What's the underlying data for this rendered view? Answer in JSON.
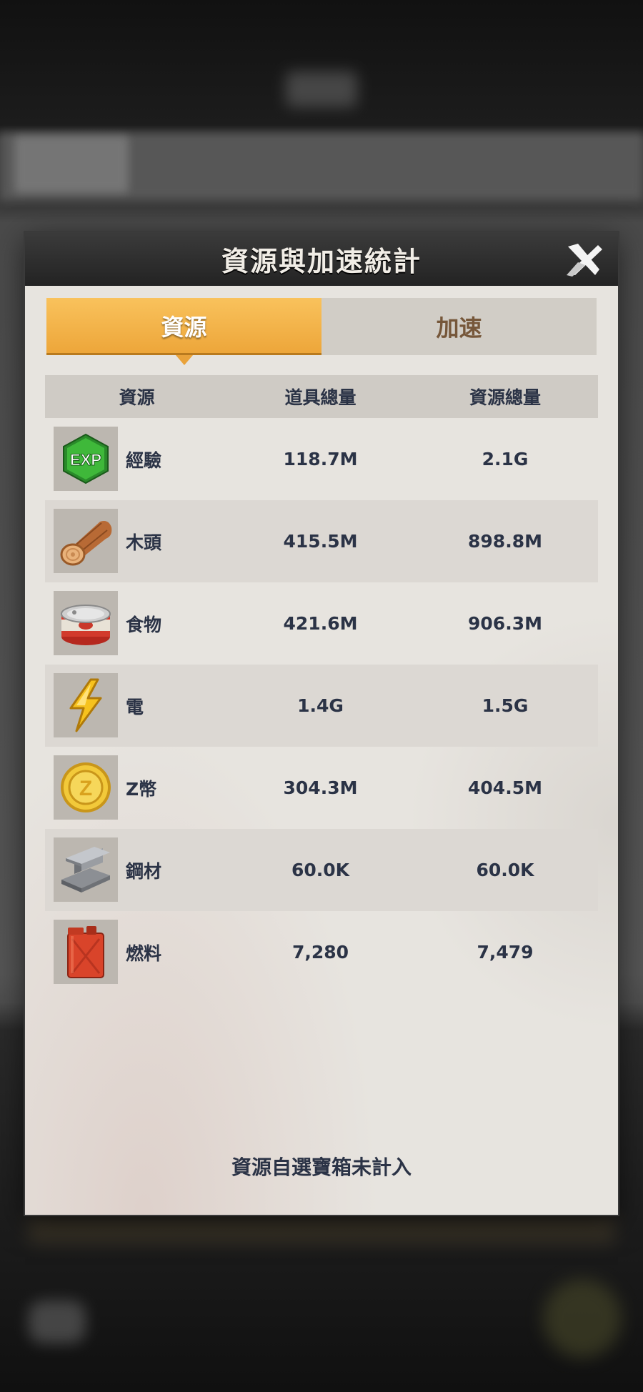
{
  "dialog": {
    "title": "資源與加速統計",
    "close_icon": "close-icon",
    "tabs": [
      {
        "label": "資源",
        "active": true
      },
      {
        "label": "加速",
        "active": false
      }
    ],
    "columns": [
      "資源",
      "道具總量",
      "資源總量"
    ],
    "rows": [
      {
        "icon": "exp-hexagon-icon",
        "name": "經驗",
        "item_total": "118.7M",
        "resource_total": "2.1G"
      },
      {
        "icon": "wood-log-icon",
        "name": "木頭",
        "item_total": "415.5M",
        "resource_total": "898.8M"
      },
      {
        "icon": "food-can-icon",
        "name": "食物",
        "item_total": "421.6M",
        "resource_total": "906.3M"
      },
      {
        "icon": "lightning-icon",
        "name": "電",
        "item_total": "1.4G",
        "resource_total": "1.5G"
      },
      {
        "icon": "z-coin-icon",
        "name": "Z幣",
        "item_total": "304.3M",
        "resource_total": "404.5M"
      },
      {
        "icon": "steel-beam-icon",
        "name": "鋼材",
        "item_total": "60.0K",
        "resource_total": "60.0K"
      },
      {
        "icon": "fuel-jerrycan-icon",
        "name": "燃料",
        "item_total": "7,280",
        "resource_total": "7,479"
      }
    ],
    "footer_note": "資源自選寶箱未計入"
  },
  "colors": {
    "tab_active": "#f0ad45",
    "text": "#2b3346",
    "panel": "#e7e4df",
    "header": "#2c2c2c"
  }
}
